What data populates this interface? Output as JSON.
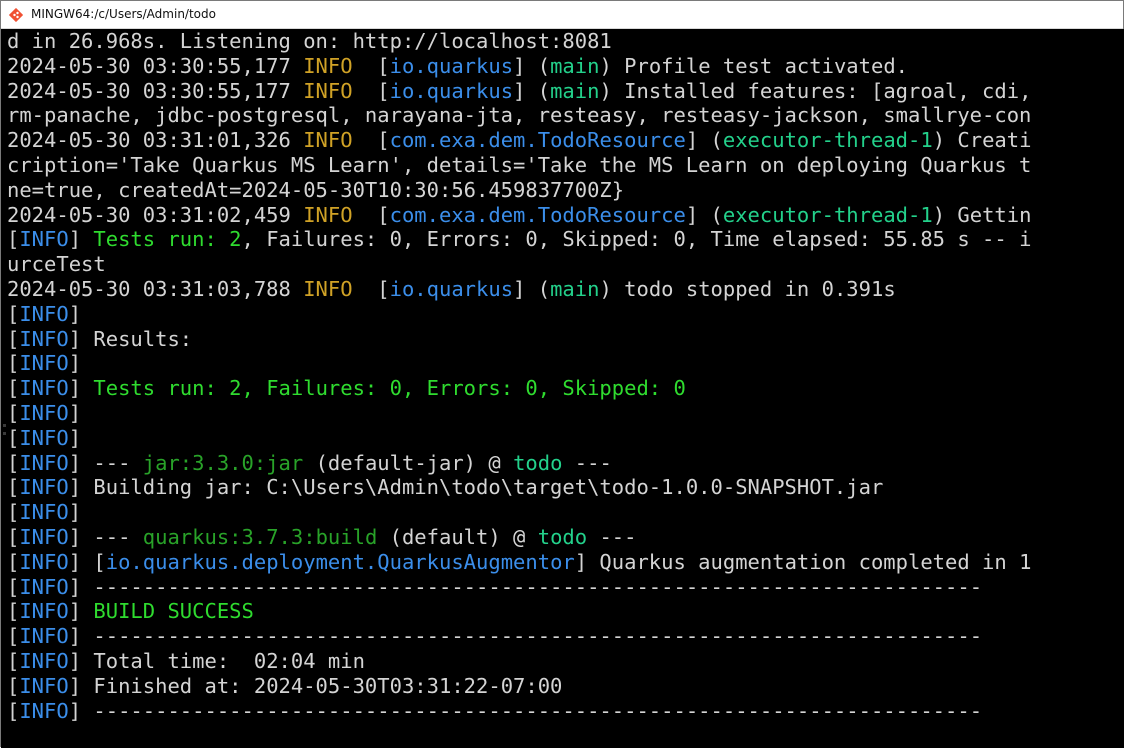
{
  "window": {
    "title": "MINGW64:/c/Users/Admin/todo",
    "icon": "git-bash-icon"
  },
  "colors": {
    "background": "#000000",
    "text": "#d4d4d4",
    "info_yellow": "#d0a226",
    "info_blue": "#3b8eea",
    "thread_green": "#23d18b",
    "success_green": "#2fdc2f"
  },
  "terminal": {
    "lines": [
      [
        {
          "t": "d in 26.968s. Listening on: http://localhost:8081",
          "c": "def"
        }
      ],
      [
        {
          "t": "2024-05-30 03:30:55,177 ",
          "c": "def"
        },
        {
          "t": "INFO",
          "c": "yellow"
        },
        {
          "t": "  [",
          "c": "def"
        },
        {
          "t": "io.quarkus",
          "c": "blue"
        },
        {
          "t": "] (",
          "c": "def"
        },
        {
          "t": "main",
          "c": "green"
        },
        {
          "t": ") Profile test activated.",
          "c": "def"
        }
      ],
      [
        {
          "t": "2024-05-30 03:30:55,177 ",
          "c": "def"
        },
        {
          "t": "INFO",
          "c": "yellow"
        },
        {
          "t": "  [",
          "c": "def"
        },
        {
          "t": "io.quarkus",
          "c": "blue"
        },
        {
          "t": "] (",
          "c": "def"
        },
        {
          "t": "main",
          "c": "green"
        },
        {
          "t": ") Installed features: [agroal, cdi,",
          "c": "def"
        }
      ],
      [
        {
          "t": "rm-panache, jdbc-postgresql, narayana-jta, resteasy, resteasy-jackson, smallrye-con",
          "c": "def"
        }
      ],
      [
        {
          "t": "2024-05-30 03:31:01,326 ",
          "c": "def"
        },
        {
          "t": "INFO",
          "c": "yellow"
        },
        {
          "t": "  [",
          "c": "def"
        },
        {
          "t": "com.exa.dem.TodoResource",
          "c": "blue"
        },
        {
          "t": "] (",
          "c": "def"
        },
        {
          "t": "executor-thread-1",
          "c": "green"
        },
        {
          "t": ") Creati",
          "c": "def"
        }
      ],
      [
        {
          "t": "cription='Take Quarkus MS Learn', details='Take the MS Learn on deploying Quarkus t",
          "c": "def"
        }
      ],
      [
        {
          "t": "ne=true, createdAt=2024-05-30T10:30:56.459837700Z}",
          "c": "def"
        }
      ],
      [
        {
          "t": "2024-05-30 03:31:02,459 ",
          "c": "def"
        },
        {
          "t": "INFO",
          "c": "yellow"
        },
        {
          "t": "  [",
          "c": "def"
        },
        {
          "t": "com.exa.dem.TodoResource",
          "c": "blue"
        },
        {
          "t": "] (",
          "c": "def"
        },
        {
          "t": "executor-thread-1",
          "c": "green"
        },
        {
          "t": ") Gettin",
          "c": "def"
        }
      ],
      [
        {
          "t": "[",
          "c": "def"
        },
        {
          "t": "INFO",
          "c": "blue"
        },
        {
          "t": "] ",
          "c": "def"
        },
        {
          "t": "Tests run: 2",
          "c": "lime"
        },
        {
          "t": ", Failures: 0, Errors: 0, Skipped: 0, Time elapsed: 55.85 s -- i",
          "c": "def"
        }
      ],
      [
        {
          "t": "urceTest",
          "c": "def"
        }
      ],
      [
        {
          "t": "2024-05-30 03:31:03,788 ",
          "c": "def"
        },
        {
          "t": "INFO",
          "c": "yellow"
        },
        {
          "t": "  [",
          "c": "def"
        },
        {
          "t": "io.quarkus",
          "c": "blue"
        },
        {
          "t": "] (",
          "c": "def"
        },
        {
          "t": "main",
          "c": "green"
        },
        {
          "t": ") todo stopped in 0.391s",
          "c": "def"
        }
      ],
      [
        {
          "t": "[",
          "c": "def"
        },
        {
          "t": "INFO",
          "c": "blue"
        },
        {
          "t": "]",
          "c": "def"
        }
      ],
      [
        {
          "t": "[",
          "c": "def"
        },
        {
          "t": "INFO",
          "c": "blue"
        },
        {
          "t": "] Results:",
          "c": "def"
        }
      ],
      [
        {
          "t": "[",
          "c": "def"
        },
        {
          "t": "INFO",
          "c": "blue"
        },
        {
          "t": "]",
          "c": "def"
        }
      ],
      [
        {
          "t": "[",
          "c": "def"
        },
        {
          "t": "INFO",
          "c": "blue"
        },
        {
          "t": "] ",
          "c": "def"
        },
        {
          "t": "Tests run: 2, Failures: 0, Errors: 0, Skipped: 0",
          "c": "lime"
        }
      ],
      [
        {
          "t": "[",
          "c": "def"
        },
        {
          "t": "INFO",
          "c": "blue"
        },
        {
          "t": "]",
          "c": "def"
        }
      ],
      [
        {
          "t": "[",
          "c": "def"
        },
        {
          "t": "INFO",
          "c": "blue"
        },
        {
          "t": "]",
          "c": "def"
        }
      ],
      [
        {
          "t": "[",
          "c": "def"
        },
        {
          "t": "INFO",
          "c": "blue"
        },
        {
          "t": "] --- ",
          "c": "def"
        },
        {
          "t": "jar:3.3.0:jar",
          "c": "dim"
        },
        {
          "t": " (default-jar) @ ",
          "c": "def"
        },
        {
          "t": "todo",
          "c": "green"
        },
        {
          "t": " ---",
          "c": "def"
        }
      ],
      [
        {
          "t": "[",
          "c": "def"
        },
        {
          "t": "INFO",
          "c": "blue"
        },
        {
          "t": "] Building jar: C:\\Users\\Admin\\todo\\target\\todo-1.0.0-SNAPSHOT.jar",
          "c": "def"
        }
      ],
      [
        {
          "t": "[",
          "c": "def"
        },
        {
          "t": "INFO",
          "c": "blue"
        },
        {
          "t": "]",
          "c": "def"
        }
      ],
      [
        {
          "t": "[",
          "c": "def"
        },
        {
          "t": "INFO",
          "c": "blue"
        },
        {
          "t": "] --- ",
          "c": "def"
        },
        {
          "t": "quarkus:3.7.3:build",
          "c": "dim"
        },
        {
          "t": " (default) @ ",
          "c": "def"
        },
        {
          "t": "todo",
          "c": "green"
        },
        {
          "t": " ---",
          "c": "def"
        }
      ],
      [
        {
          "t": "[",
          "c": "def"
        },
        {
          "t": "INFO",
          "c": "blue"
        },
        {
          "t": "] [",
          "c": "def"
        },
        {
          "t": "io.quarkus.deployment.QuarkusAugmentor",
          "c": "blue"
        },
        {
          "t": "] Quarkus augmentation completed in 1",
          "c": "def"
        }
      ],
      [
        {
          "t": "[",
          "c": "def"
        },
        {
          "t": "INFO",
          "c": "blue"
        },
        {
          "t": "] ------------------------------------------------------------------------",
          "c": "def"
        }
      ],
      [
        {
          "t": "[",
          "c": "def"
        },
        {
          "t": "INFO",
          "c": "blue"
        },
        {
          "t": "] ",
          "c": "def"
        },
        {
          "t": "BUILD SUCCESS",
          "c": "lime"
        }
      ],
      [
        {
          "t": "[",
          "c": "def"
        },
        {
          "t": "INFO",
          "c": "blue"
        },
        {
          "t": "] ------------------------------------------------------------------------",
          "c": "def"
        }
      ],
      [
        {
          "t": "[",
          "c": "def"
        },
        {
          "t": "INFO",
          "c": "blue"
        },
        {
          "t": "] Total time:  02:04 min",
          "c": "def"
        }
      ],
      [
        {
          "t": "[",
          "c": "def"
        },
        {
          "t": "INFO",
          "c": "blue"
        },
        {
          "t": "] Finished at: 2024-05-30T03:31:22-07:00",
          "c": "def"
        }
      ],
      [
        {
          "t": "[",
          "c": "def"
        },
        {
          "t": "INFO",
          "c": "blue"
        },
        {
          "t": "] ------------------------------------------------------------------------",
          "c": "def"
        }
      ]
    ]
  }
}
